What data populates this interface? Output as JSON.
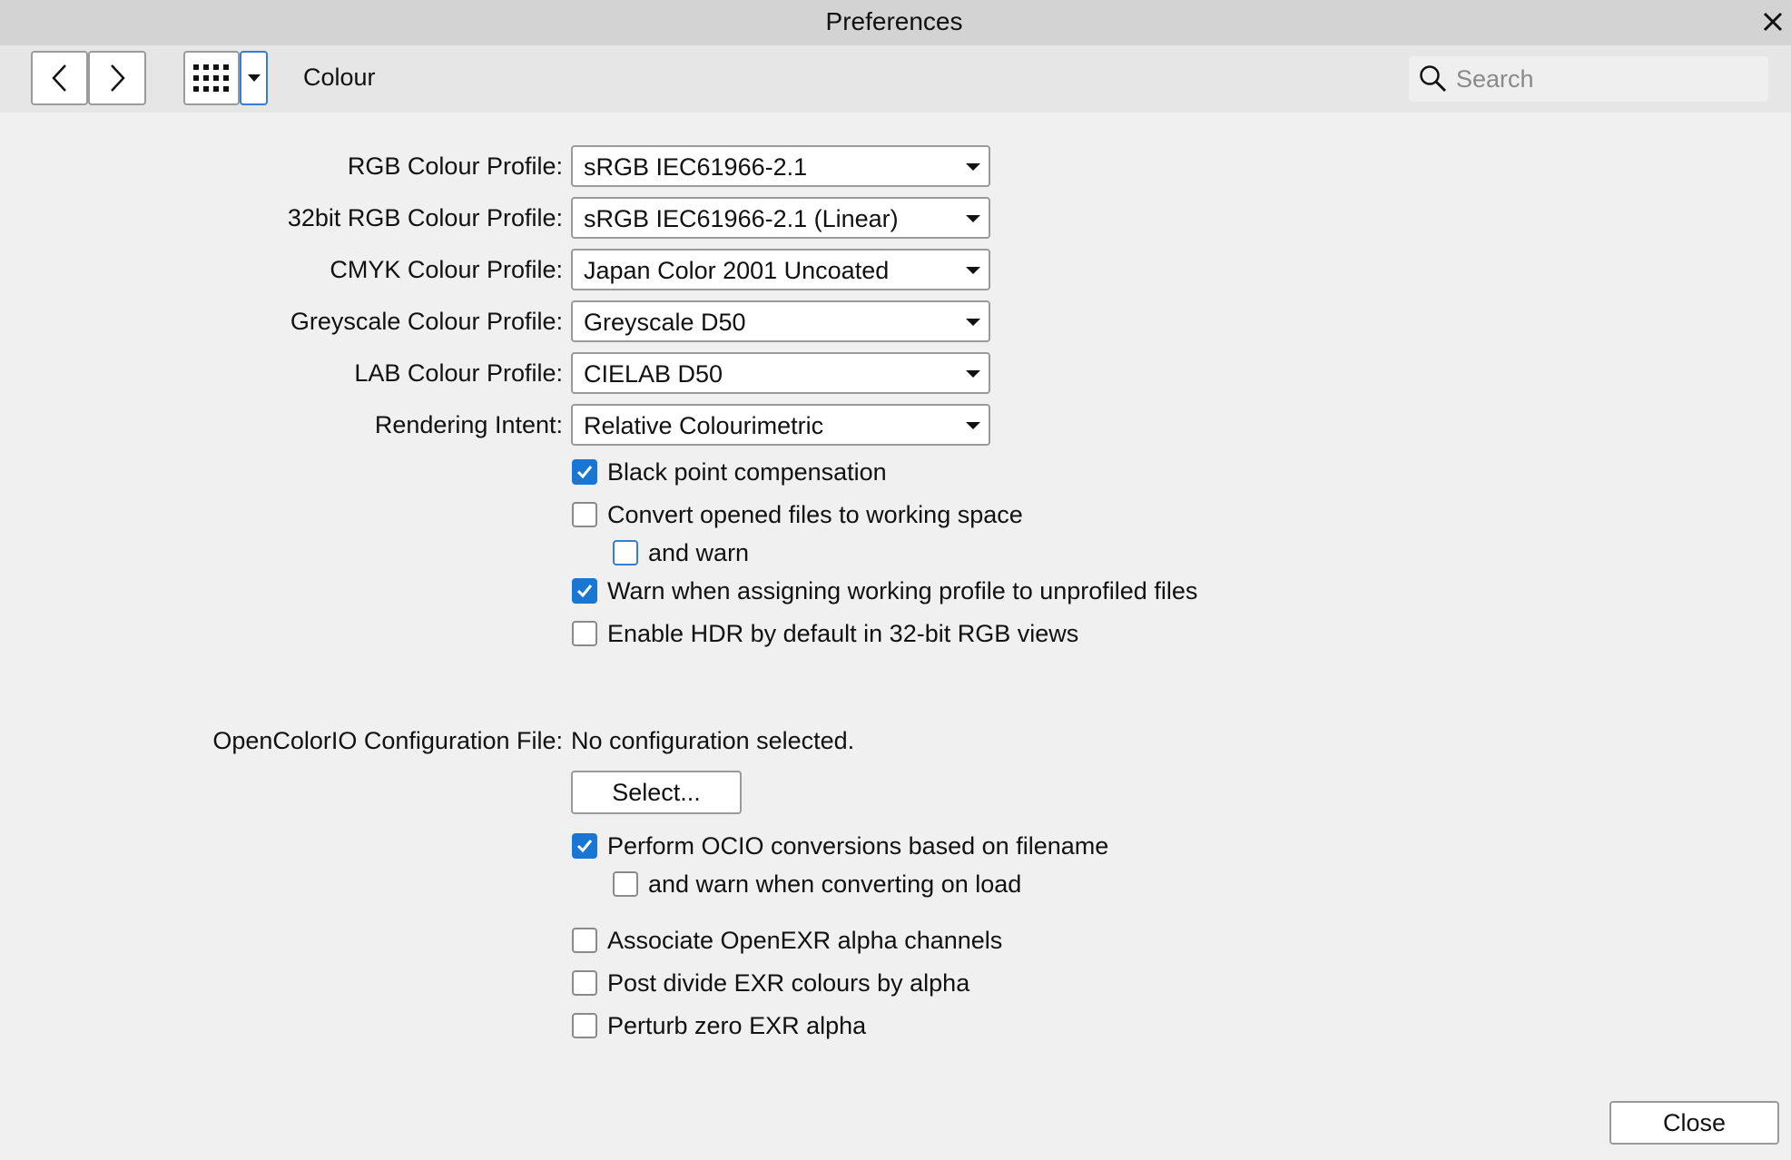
{
  "window": {
    "title": "Preferences"
  },
  "toolbar": {
    "back_icon": "chevron-left",
    "forward_icon": "chevron-right",
    "grid_icon": "grid",
    "breadcrumb": "Colour",
    "search_placeholder": "Search"
  },
  "profiles": [
    {
      "label": "RGB Colour Profile:",
      "value": "sRGB IEC61966-2.1"
    },
    {
      "label": "32bit RGB Colour Profile:",
      "value": "sRGB IEC61966-2.1 (Linear)"
    },
    {
      "label": "CMYK Colour Profile:",
      "value": "Japan Color 2001 Uncoated"
    },
    {
      "label": "Greyscale Colour Profile:",
      "value": "Greyscale D50"
    },
    {
      "label": "LAB Colour Profile:",
      "value": "CIELAB D50"
    },
    {
      "label": "Rendering Intent:",
      "value": "Relative Colourimetric"
    }
  ],
  "options": [
    {
      "label": "Black point compensation",
      "checked": true
    },
    {
      "label": "Convert opened files to working space",
      "checked": false
    },
    {
      "label": "and warn",
      "checked": false
    },
    {
      "label": "Warn when assigning working profile to unprofiled files",
      "checked": true
    },
    {
      "label": "Enable HDR by default in 32-bit RGB views",
      "checked": false
    }
  ],
  "ocio": {
    "label": "OpenColorIO Configuration File:",
    "value": "No configuration selected.",
    "select_button": "Select..."
  },
  "ocio_options": [
    {
      "label": "Perform OCIO conversions based on filename",
      "checked": true
    },
    {
      "label": "and warn when converting on load",
      "checked": false
    },
    {
      "label": "Associate OpenEXR alpha channels",
      "checked": false
    },
    {
      "label": "Post divide EXR colours by alpha",
      "checked": false
    },
    {
      "label": "Perturb zero EXR alpha",
      "checked": false
    }
  ],
  "footer": {
    "close_button": "Close"
  },
  "colors": {
    "accent": "#1976d2",
    "title_bar": "#d3d3d3",
    "background": "#f0f0f0"
  }
}
